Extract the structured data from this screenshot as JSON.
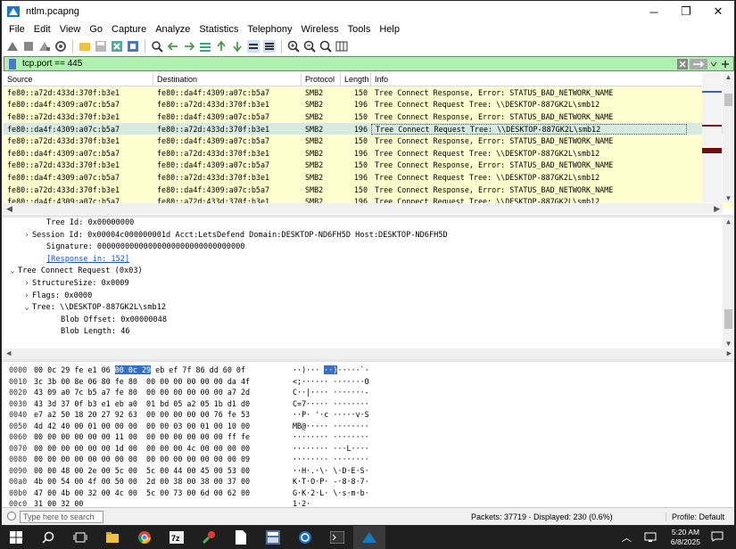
{
  "window": {
    "title": "ntlm.pcapng",
    "minimize": "─",
    "restore": "❐",
    "close": "✕"
  },
  "menu": [
    "File",
    "Edit",
    "View",
    "Go",
    "Capture",
    "Analyze",
    "Statistics",
    "Telephony",
    "Wireless",
    "Tools",
    "Help"
  ],
  "toolbar_icons": [
    "shark-fin-start-icon",
    "stop-square-icon",
    "restart-shark-icon",
    "options-gear-icon",
    "open-folder-icon",
    "save-file-icon",
    "close-file-icon",
    "reload-icon",
    "search-packet-icon",
    "back-arrow-icon",
    "forward-arrow-icon",
    "go-to-packet-icon",
    "first-packet-icon",
    "last-packet-icon",
    "autoscroll-icon",
    "colorize-icon",
    "zoom-in-icon",
    "zoom-out-icon",
    "zoom-reset-icon",
    "resize-columns-icon"
  ],
  "filter": {
    "value": "tcp.port == 445"
  },
  "packet_list": {
    "columns": [
      "Source",
      "Destination",
      "Protocol",
      "Length",
      "Info"
    ],
    "rows": [
      {
        "src": "fe80::a72d:433d:370f:b3e1",
        "dst": "fe80::da4f:4309:a07c:b5a7",
        "proto": "SMB2",
        "len": "150",
        "info": "Tree Connect Response, Error: STATUS_BAD_NETWORK_NAME"
      },
      {
        "src": "fe80::da4f:4309:a07c:b5a7",
        "dst": "fe80::a72d:433d:370f:b3e1",
        "proto": "SMB2",
        "len": "196",
        "info": "Tree Connect Request Tree: \\\\DESKTOP-887GK2L\\smb12"
      },
      {
        "src": "fe80::a72d:433d:370f:b3e1",
        "dst": "fe80::da4f:4309:a07c:b5a7",
        "proto": "SMB2",
        "len": "150",
        "info": "Tree Connect Response, Error: STATUS_BAD_NETWORK_NAME"
      },
      {
        "src": "fe80::da4f:4309:a07c:b5a7",
        "dst": "fe80::a72d:433d:370f:b3e1",
        "proto": "SMB2",
        "len": "196",
        "info": "Tree Connect Request Tree: \\\\DESKTOP-887GK2L\\smb12"
      },
      {
        "src": "fe80::a72d:433d:370f:b3e1",
        "dst": "fe80::da4f:4309:a07c:b5a7",
        "proto": "SMB2",
        "len": "150",
        "info": "Tree Connect Response, Error: STATUS_BAD_NETWORK_NAME"
      },
      {
        "src": "fe80::da4f:4309:a07c:b5a7",
        "dst": "fe80::a72d:433d:370f:b3e1",
        "proto": "SMB2",
        "len": "196",
        "info": "Tree Connect Request Tree: \\\\DESKTOP-887GK2L\\smb12"
      },
      {
        "src": "fe80::a72d:433d:370f:b3e1",
        "dst": "fe80::da4f:4309:a07c:b5a7",
        "proto": "SMB2",
        "len": "150",
        "info": "Tree Connect Response, Error: STATUS_BAD_NETWORK_NAME"
      },
      {
        "src": "fe80::da4f:4309:a07c:b5a7",
        "dst": "fe80::a72d:433d:370f:b3e1",
        "proto": "SMB2",
        "len": "196",
        "info": "Tree Connect Request Tree: \\\\DESKTOP-887GK2L\\smb12"
      },
      {
        "src": "fe80::a72d:433d:370f:b3e1",
        "dst": "fe80::da4f:4309:a07c:b5a7",
        "proto": "SMB2",
        "len": "150",
        "info": "Tree Connect Response, Error: STATUS_BAD_NETWORK_NAME"
      },
      {
        "src": "fe80::da4f:4309:a07c:b5a7",
        "dst": "fe80::a72d:433d:370f:b3e1",
        "proto": "SMB2",
        "len": "196",
        "info": "Tree Connect Request Tree: \\\\DESKTOP-887GK2L\\smb12"
      }
    ],
    "selected_index": 3
  },
  "details": [
    {
      "indent": 3,
      "arrow": "",
      "text": "Tree Id: 0x00000000"
    },
    {
      "indent": 2,
      "arrow": "›",
      "text": "Session Id: 0x00004c000000001d Acct:LetsDefend Domain:DESKTOP-ND6FH5D Host:DESKTOP-ND6FH5D"
    },
    {
      "indent": 3,
      "arrow": "",
      "text": "Signature: 00000000000000000000000000000000"
    },
    {
      "indent": 3,
      "arrow": "",
      "text": "[Response in: 152]",
      "link": true
    },
    {
      "indent": 1,
      "arrow": "⌄",
      "text": "Tree Connect Request (0x03)"
    },
    {
      "indent": 2,
      "arrow": "›",
      "text": "StructureSize: 0x0009"
    },
    {
      "indent": 2,
      "arrow": "›",
      "text": "Flags: 0x0000"
    },
    {
      "indent": 2,
      "arrow": "⌄",
      "text": "Tree: \\\\DESKTOP-887GK2L\\smb12"
    },
    {
      "indent": 4,
      "arrow": "",
      "text": "Blob Offset: 0x00000048"
    },
    {
      "indent": 4,
      "arrow": "",
      "text": "Blob Length: 46"
    }
  ],
  "hex": [
    {
      "off": "0000",
      "bytes": [
        "00 0c 29 fe e1 06 ",
        "00 0c 29",
        " eb ef 7f 86 dd 60 0f"
      ],
      "ascii": [
        "··)··· ",
        "··)",
        "·····`·"
      ]
    },
    {
      "off": "0010",
      "bytes": [
        "3c 3b 00 8e 06 80 fe 80  00 00 00 00 00 00 da 4f"
      ],
      "ascii": [
        "<;······ ·······O"
      ]
    },
    {
      "off": "0020",
      "bytes": [
        "43 09 a0 7c b5 a7 fe 80  00 00 00 00 00 00 a7 2d"
      ],
      "ascii": [
        "C··|···· ·······-"
      ]
    },
    {
      "off": "0030",
      "bytes": [
        "43 3d 37 0f b3 e1 eb a0  01 bd 05 a2 05 1b d1 d0"
      ],
      "ascii": [
        "C=7····· ········"
      ]
    },
    {
      "off": "0040",
      "bytes": [
        "e7 a2 50 18 20 27 92 63  00 00 00 00 00 76 fe 53"
      ],
      "ascii": [
        "··P· '·c ·····v·S"
      ]
    },
    {
      "off": "0050",
      "bytes": [
        "4d 42 40 00 01 00 00 00  00 00 03 00 01 00 10 00"
      ],
      "ascii": [
        "MB@····· ········"
      ]
    },
    {
      "off": "0060",
      "bytes": [
        "00 00 00 00 00 00 11 00  00 00 00 00 00 00 ff fe"
      ],
      "ascii": [
        "········ ········"
      ]
    },
    {
      "off": "0070",
      "bytes": [
        "00 00 00 00 00 00 1d 00  00 00 00 4c 00 00 00 00"
      ],
      "ascii": [
        "········ ···L····"
      ]
    },
    {
      "off": "0080",
      "bytes": [
        "00 00 00 00 00 00 00 00  00 00 00 00 00 00 00 09"
      ],
      "ascii": [
        "········ ········"
      ]
    },
    {
      "off": "0090",
      "bytes": [
        "00 00 48 00 2e 00 5c 00  5c 00 44 00 45 00 53 00"
      ],
      "ascii": [
        "··H·.·\\· \\·D·E·S·"
      ]
    },
    {
      "off": "00a0",
      "bytes": [
        "4b 00 54 00 4f 00 50 00  2d 00 38 00 38 00 37 00"
      ],
      "ascii": [
        "K·T·O·P· -·8·8·7·"
      ]
    },
    {
      "off": "00b0",
      "bytes": [
        "47 00 4b 00 32 00 4c 00  5c 00 73 00 6d 00 62 00"
      ],
      "ascii": [
        "G·K·2·L· \\·s·m·b·"
      ]
    },
    {
      "off": "00c0",
      "bytes": [
        "31 00 32 00"
      ],
      "ascii": [
        "1·2·"
      ]
    }
  ],
  "status": {
    "search_placeholder": "Type here to search",
    "packets": "Packets: 37719 · Displayed: 230 (0.6%)",
    "profile": "Profile: Default"
  },
  "taskbar": {
    "icons": [
      "windows-start-icon",
      "search-icon",
      "task-view-icon",
      "file-explorer-icon",
      "chrome-icon",
      "7zip-icon",
      "paint-icon",
      "document-icon",
      "calculator-icon",
      "network-icon",
      "terminal-icon",
      "wireshark-icon"
    ],
    "time": "5:20 AM",
    "date": "6/8/2025"
  }
}
